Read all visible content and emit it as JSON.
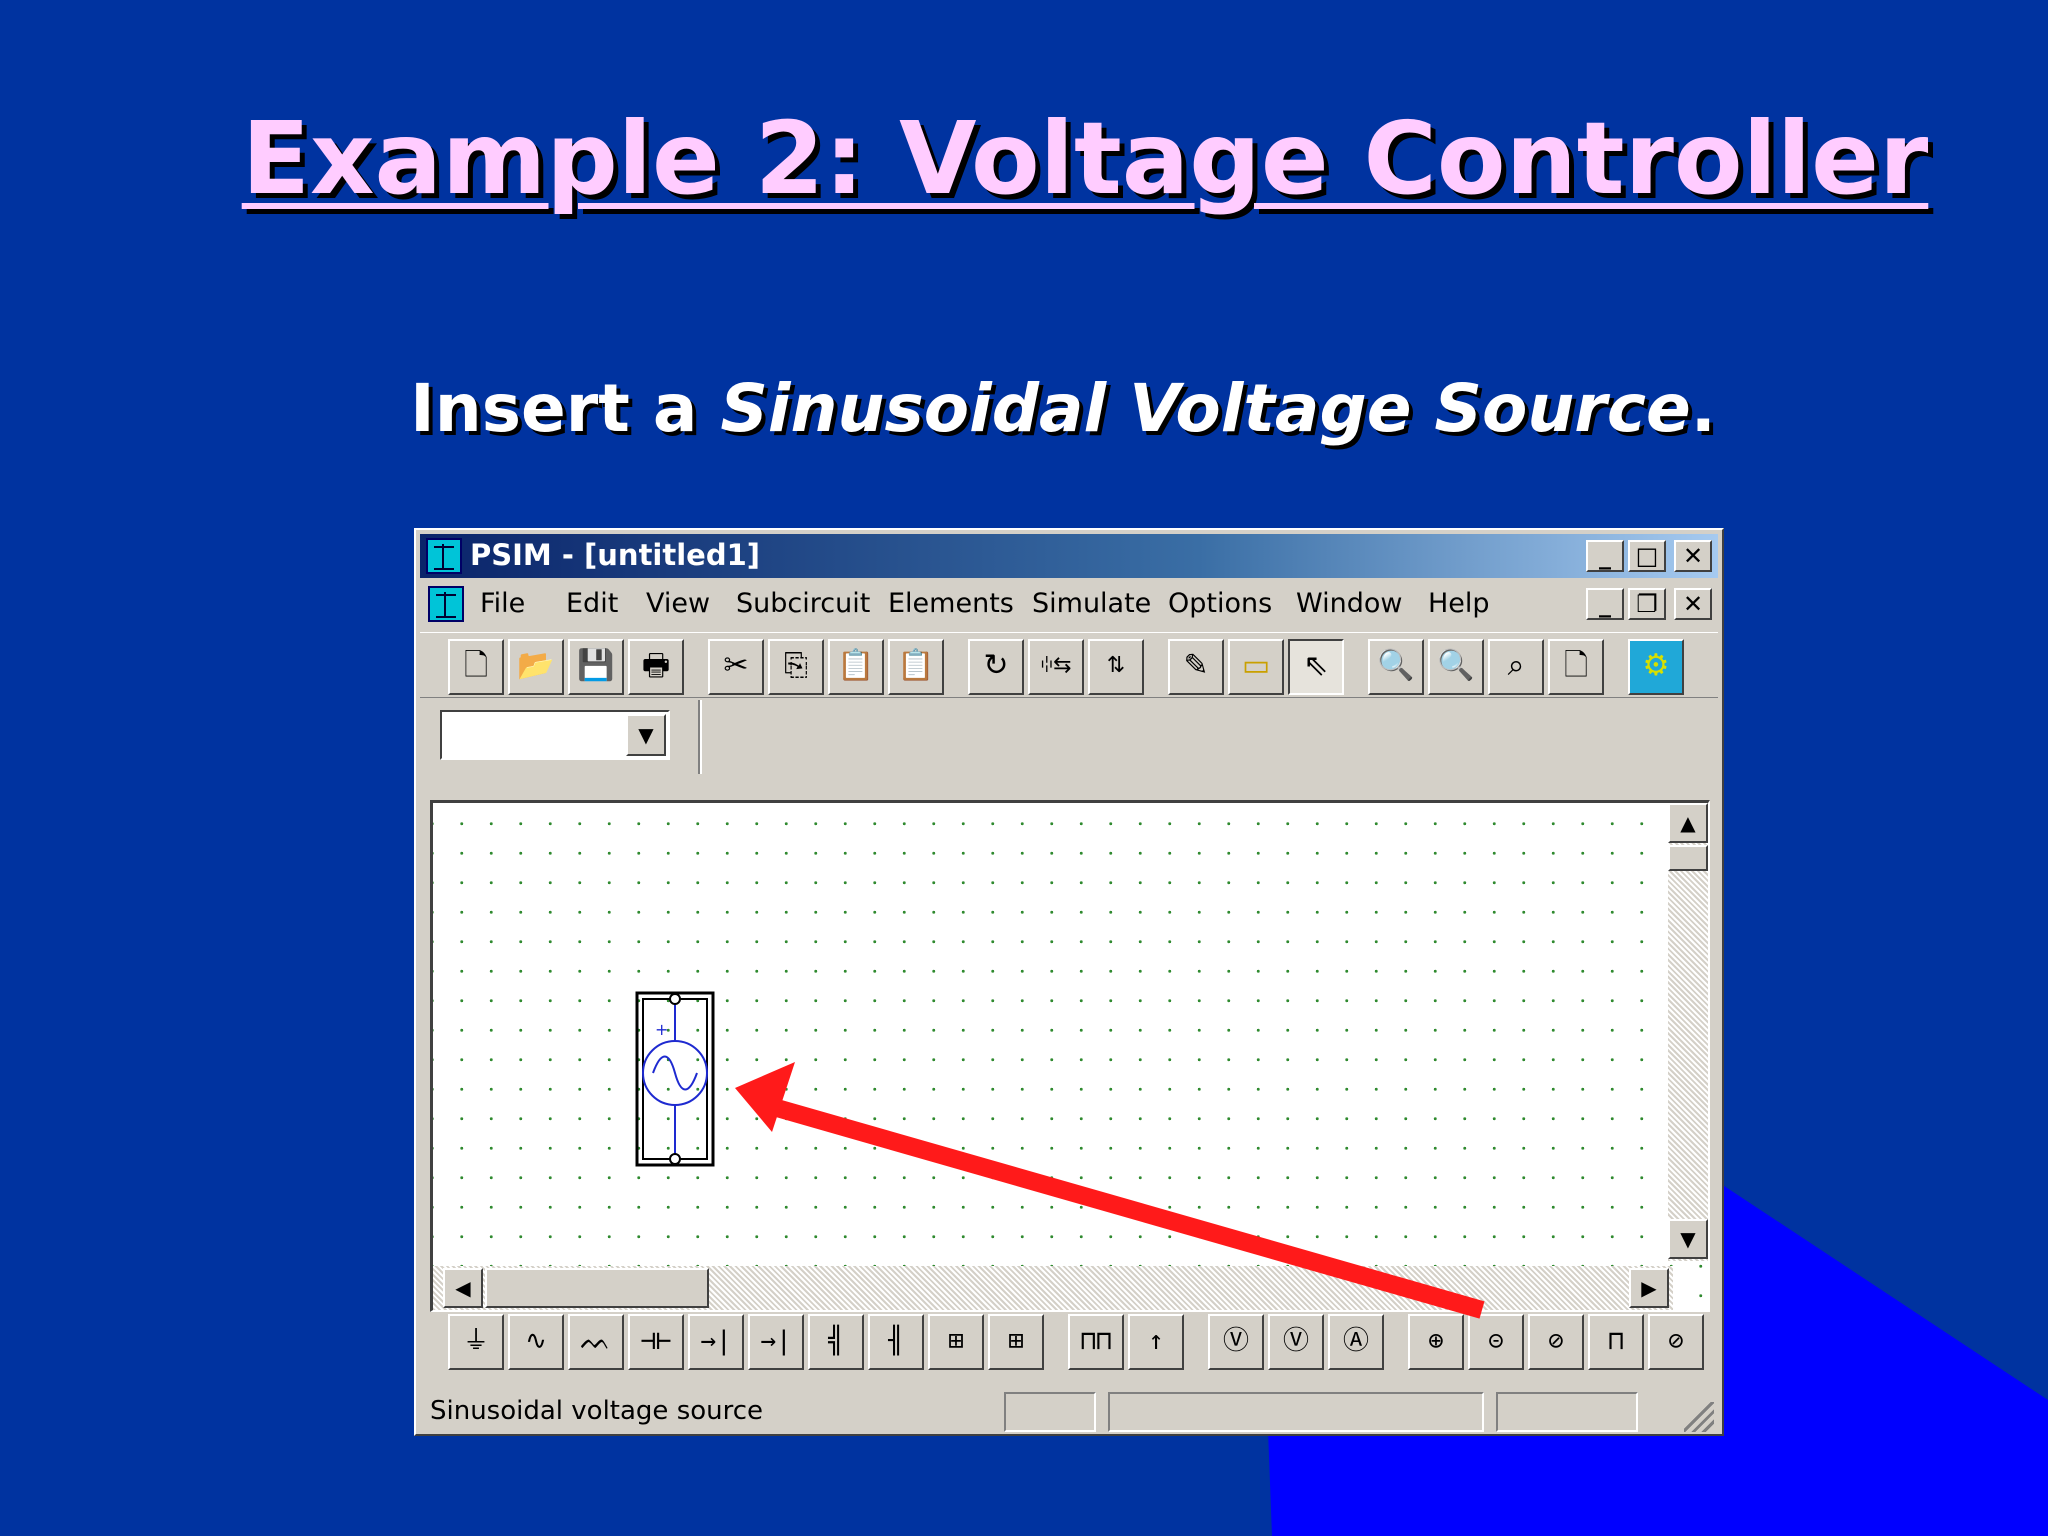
{
  "slide": {
    "title": "Example 2: Voltage Controller",
    "subtitle_prefix": "Insert a ",
    "subtitle_emphasis": "Sinusoidal Voltage Source",
    "subtitle_suffix": "."
  },
  "window": {
    "title": "PSIM - [untitled1]",
    "caption_buttons": [
      "_",
      "□",
      "✕"
    ],
    "mdi_buttons": [
      "_",
      "❐",
      "✕"
    ]
  },
  "menu": [
    "File",
    "Edit",
    "View",
    "Subcircuit",
    "Elements",
    "Simulate",
    "Options",
    "Window",
    "Help"
  ],
  "toolbar_icons": [
    "new-icon",
    "open-icon",
    "save-icon",
    "print-icon",
    "cut-icon",
    "copy-icon",
    "paste-disabled-icon",
    "paste-icon",
    "rotate-icon",
    "flip-horizontal-icon",
    "flip-vertical-icon",
    "wire-icon",
    "label-icon",
    "select-arrow-icon",
    "zoom-in-icon",
    "zoom-out-icon",
    "zoom-selected-icon",
    "fit-page-icon",
    "run-simulation-icon"
  ],
  "combo": {
    "value": ""
  },
  "elements_icons": [
    "ground-icon",
    "resistor-icon",
    "inductor-icon",
    "capacitor-icon",
    "diode-icon",
    "thyristor-icon",
    "mosfet-icon",
    "igbt-icon",
    "switch-icon",
    "switch-pair-icon",
    "square-wave-icon",
    "node-icon",
    "voltage-probe-icon",
    "voltmeter-icon",
    "ammeter-icon",
    "dc-voltage-source-icon",
    "sinusoidal-voltage-source-icon",
    "sinusoidal-current-source-icon",
    "square-voltage-source-icon",
    "step-voltage-source-icon"
  ],
  "status": {
    "text": "Sinusoidal voltage source"
  },
  "colors": {
    "background": "#0033a0",
    "title": "#ffccff",
    "arrow": "#ff1a1a",
    "accent_shape": "#0000ff"
  }
}
